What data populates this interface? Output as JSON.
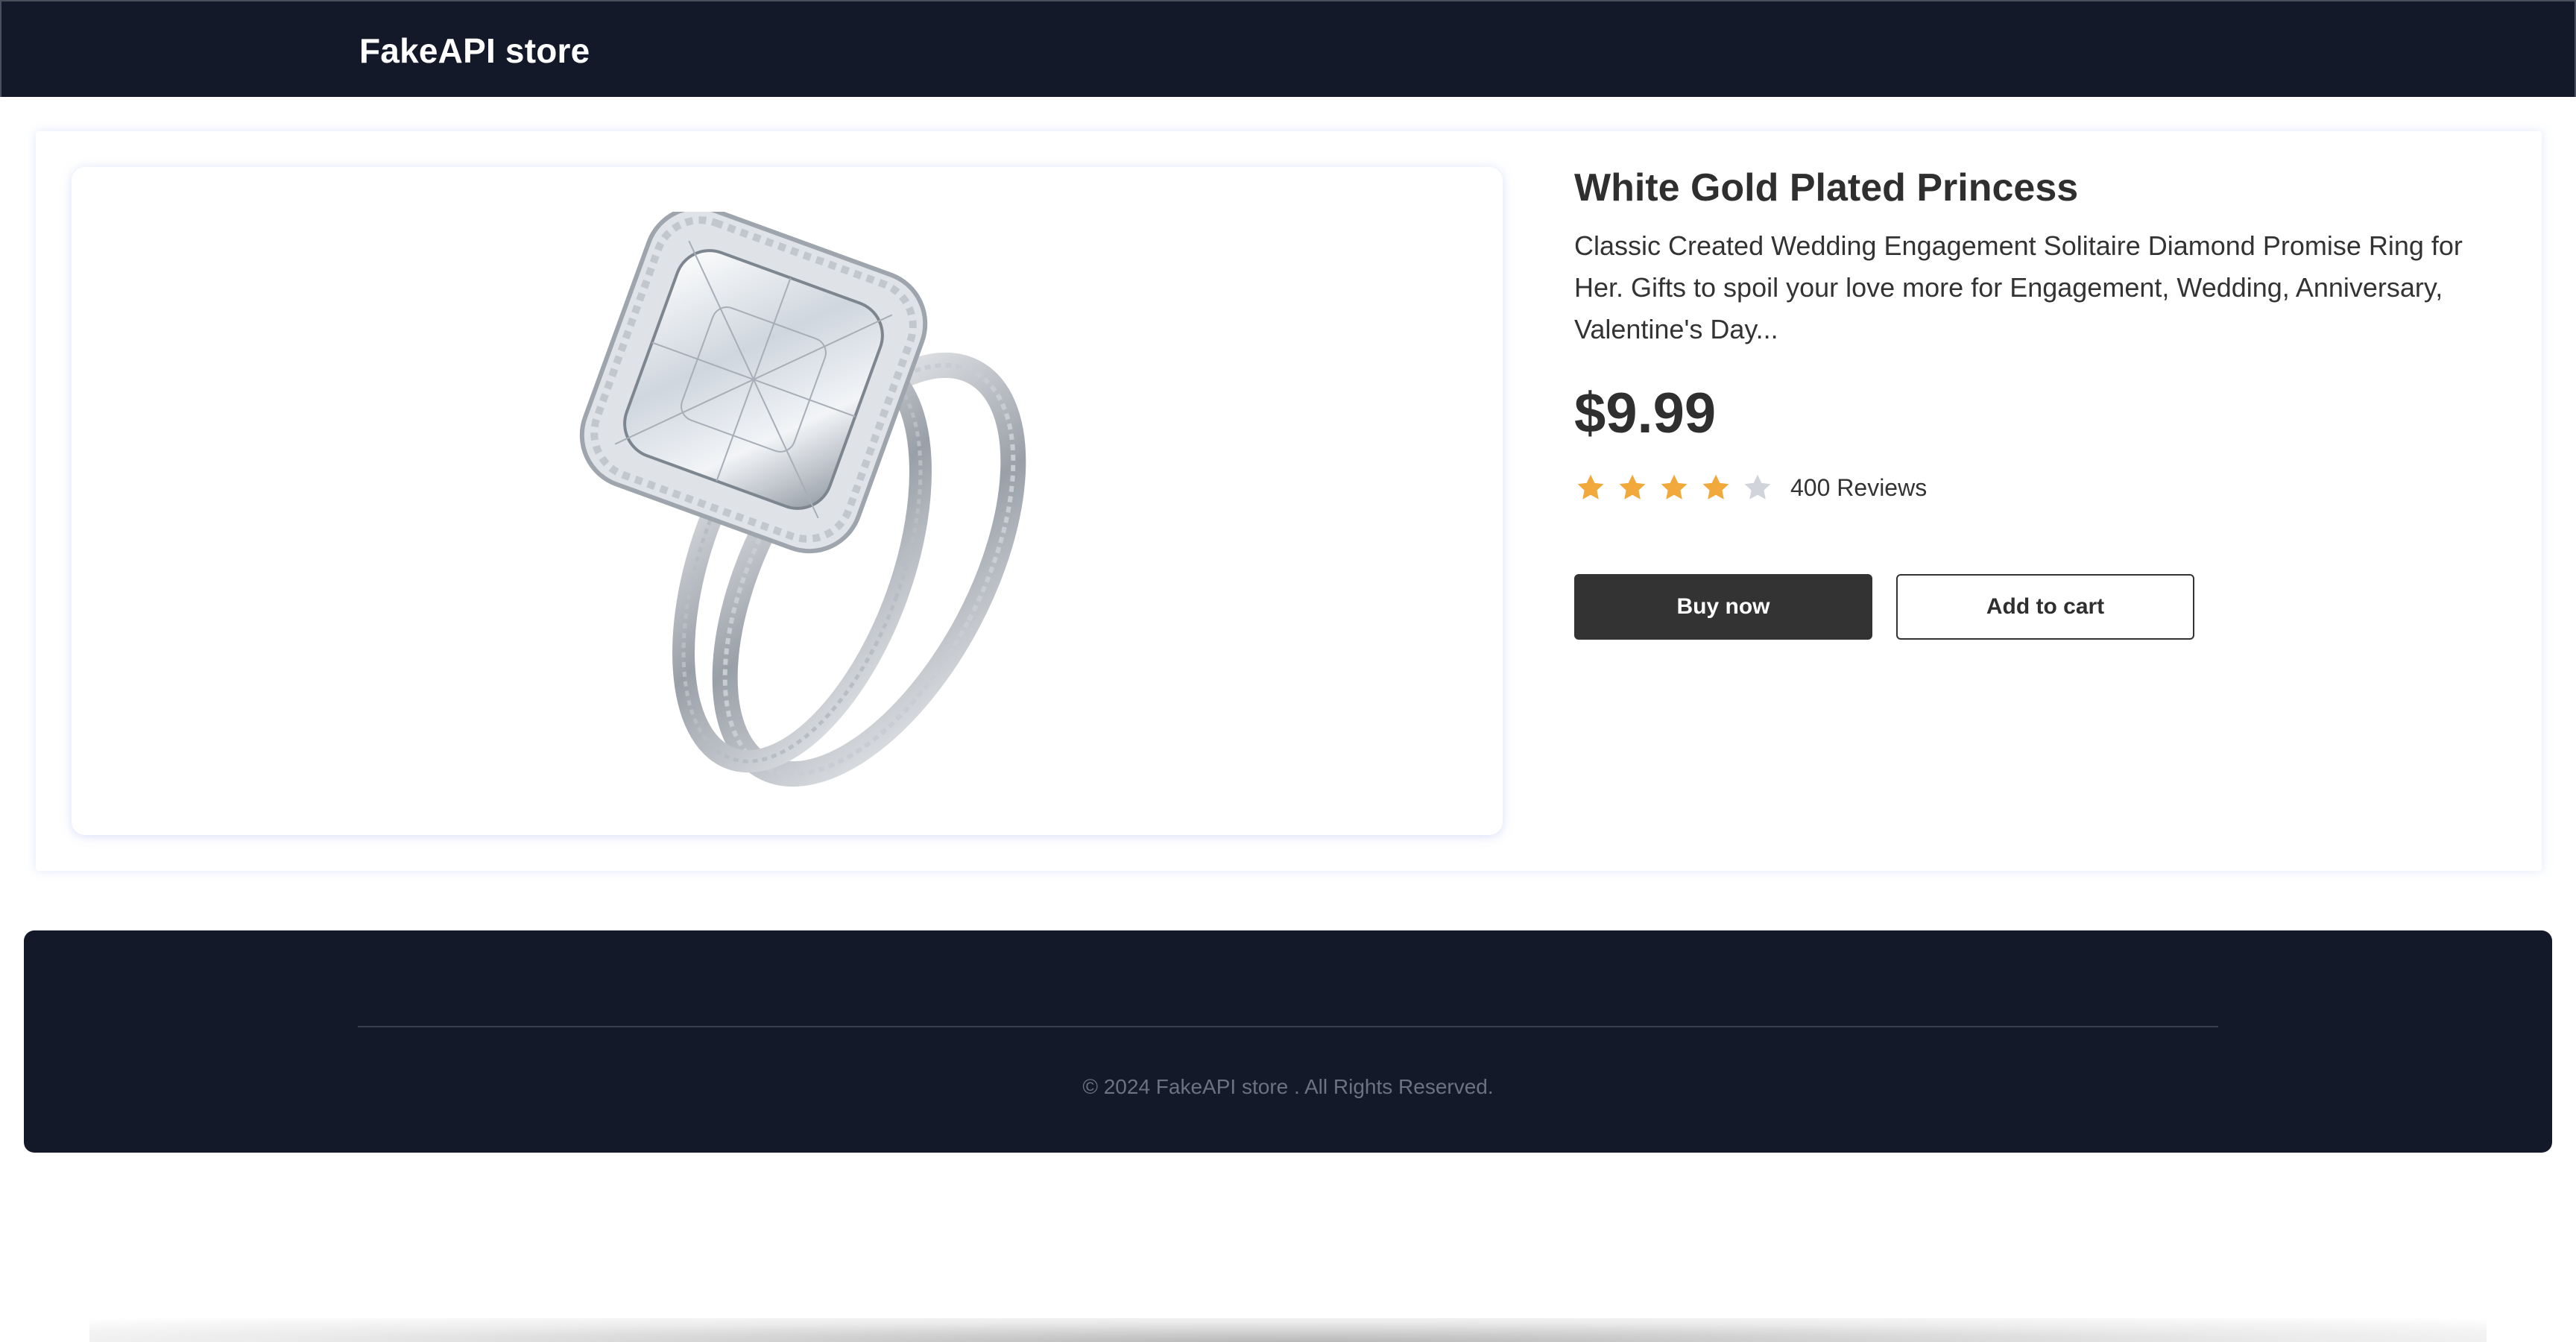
{
  "header": {
    "brand": "FakeAPI store"
  },
  "product": {
    "title": "White Gold Plated Princess",
    "description": "Classic Created Wedding Engagement Solitaire Diamond Promise Ring for Her. Gifts to spoil your love more for Engagement, Wedding, Anniversary, Valentine's Day...",
    "price": "$9.99",
    "rating": {
      "value": 4,
      "max": 5,
      "filled_color": "#f2a93b",
      "empty_color": "#d1d5db",
      "reviews_label": "400 Reviews"
    },
    "buy_label": "Buy now",
    "cart_label": "Add to cart"
  },
  "footer": {
    "copyright": "© 2024 FakeAPI store . All Rights Reserved."
  },
  "colors": {
    "navbar_bg": "#131928",
    "footer_bg": "#131928",
    "primary_button": "#333333"
  },
  "icons": {
    "star": "star-icon",
    "product_image": "diamond-ring-image"
  }
}
